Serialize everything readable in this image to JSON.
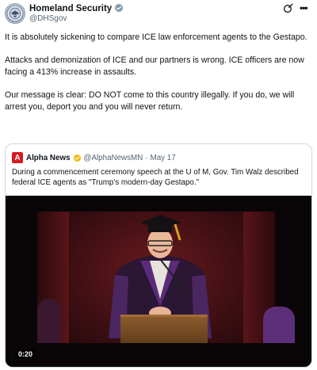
{
  "post": {
    "author_name": "Homeland Security",
    "author_handle": "@DHSgov",
    "avatar_icon": "dhs-seal-icon",
    "verified_icon": "verified-badge-icon",
    "verified_color": "#829aab",
    "more_label": "•••",
    "paragraphs": [
      "It is absolutely sickening to compare ICE law enforcement agents to the Gestapo.",
      "Attacks and demonization of ICE and our partners is wrong. ICE officers are now facing a 413% increase in assaults.",
      "Our message is clear: DO NOT come to this country illegally. If you do, we will arrest you, deport you and you will never return."
    ]
  },
  "quote": {
    "logo_letter": "A",
    "logo_color": "#d71920",
    "author_name": "Alpha News",
    "badge_color": "#f2b90f",
    "author_handle": "@AlphaNewsMN",
    "separator": "·",
    "date": "May 17",
    "text": "During a commencement ceremony speech at the U of M, Gov. Tim Walz described federal ICE agents as \"Trump's modern-day Gestapo.\"",
    "video": {
      "timestamp": "0:20"
    }
  }
}
